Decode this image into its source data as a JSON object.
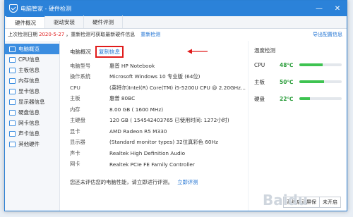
{
  "title": "电脑管家 - 硬件检测",
  "window_controls": [
    "—",
    "✕"
  ],
  "tabs": [
    "硬件概况",
    "驱动安装",
    "硬件评测"
  ],
  "notice": {
    "prefix": "上次检测日期",
    "date": "2020-5-27",
    "suffix": "，重新检测可获取最新硬件信息",
    "recheck": "重新检测",
    "export": "导出配置信息"
  },
  "sidebar": [
    {
      "label": "电脑概览",
      "icon": "monitor-icon"
    },
    {
      "label": "CPU信息",
      "icon": "cpu-icon"
    },
    {
      "label": "主板信息",
      "icon": "motherboard-icon"
    },
    {
      "label": "内存信息",
      "icon": "memory-icon"
    },
    {
      "label": "显卡信息",
      "icon": "gpu-icon"
    },
    {
      "label": "显示器信息",
      "icon": "display-icon"
    },
    {
      "label": "硬盘信息",
      "icon": "disk-icon"
    },
    {
      "label": "网卡信息",
      "icon": "network-icon"
    },
    {
      "label": "声卡信息",
      "icon": "sound-icon"
    },
    {
      "label": "其他硬件",
      "icon": "other-icon"
    }
  ],
  "overview": {
    "heading": "电脑概况",
    "copy": "复制信息",
    "rows": [
      {
        "k": "电脑型号",
        "v": "惠普 HP Notebook"
      },
      {
        "k": "操作系统",
        "v": "Microsoft Windows 10 专业版 (64位)"
      },
      {
        "k": "CPU",
        "v": "(英特尔)Intel(R) Core(TM) i5-5200U CPU @ 2.20GHz..."
      },
      {
        "k": "主板",
        "v": "惠普 80BC"
      },
      {
        "k": "内存",
        "v": "8.00 GB ( 1600 MHz)"
      },
      {
        "k": "主硬盘",
        "v": "120 GB ( 154542403765 已使用时间: 1272小时)"
      },
      {
        "k": "显卡",
        "v": "AMD Radeon R5 M330"
      },
      {
        "k": "显示器",
        "v": "(Standard monitor types) 32位真彩色 60Hz"
      },
      {
        "k": "声卡",
        "v": "Realtek High Definition Audio"
      },
      {
        "k": "网卡",
        "v": "Realtek PCIe FE Family Controller"
      }
    ],
    "bottom": "您还未评估您的电脑性能，请立即进行评测。",
    "bottom_link": "立即评测"
  },
  "temperature": {
    "heading": "温度检测",
    "rows": [
      {
        "k": "CPU",
        "v": "48℃",
        "level": 0.55
      },
      {
        "k": "主板",
        "v": "50℃",
        "level": 0.58
      },
      {
        "k": "硬盘",
        "v": "22℃",
        "level": 0.25
      }
    ]
  },
  "status": [
    "系统启动屏保",
    "未开启"
  ],
  "watermark": "Baidu"
}
